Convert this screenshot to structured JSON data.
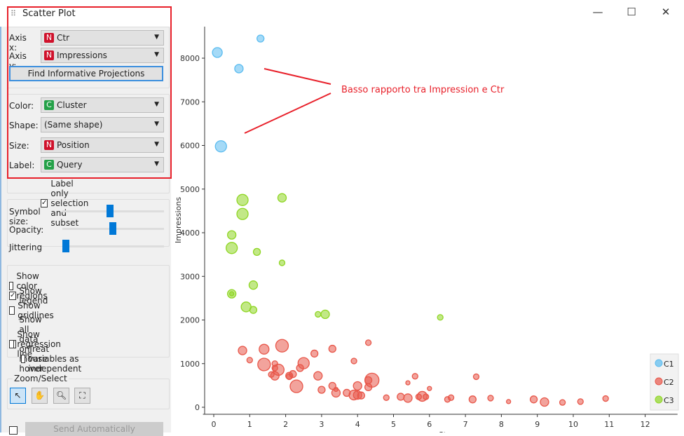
{
  "window": {
    "title": "Scatter Plot",
    "minimize": "—",
    "maximize": "☐",
    "close": "✕"
  },
  "controls": {
    "axis_x": {
      "label": "Axis x:",
      "type": "N",
      "value": "Ctr"
    },
    "axis_y": {
      "label": "Axis y:",
      "type": "N",
      "value": "Impressions"
    },
    "find_button": "Find Informative Projections",
    "color": {
      "label": "Color:",
      "type": "C",
      "value": "Cluster"
    },
    "shape": {
      "label": "Shape:",
      "value": "(Same shape)"
    },
    "size": {
      "label": "Size:",
      "type": "N",
      "value": "Position"
    },
    "label": {
      "label": "Label:",
      "type": "C",
      "value": "Query"
    },
    "label_only": {
      "label": "Label only selection and subset",
      "checked": true
    },
    "symbol_size": {
      "label": "Symbol size:",
      "value": 0.45
    },
    "opacity": {
      "label": "Opacity:",
      "value": 0.5
    },
    "jittering": {
      "label": "Jittering",
      "value": 0.0
    },
    "checkboxes": [
      {
        "label": "Show color regions",
        "checked": false
      },
      {
        "label": "Show legend",
        "checked": true
      },
      {
        "label": "Show gridlines",
        "checked": false
      },
      {
        "label": "Show all data on mouse hover",
        "checked": true
      },
      {
        "label": "Show regression line",
        "checked": false
      },
      {
        "label": "Treat variables as independent",
        "checked": false
      }
    ],
    "zoom_select": "Zoom/Select",
    "send_button": "Send Automatically"
  },
  "chart_data": {
    "type": "scatter",
    "xlabel": "Ctr",
    "ylabel": "Impressions",
    "xlim": [
      -0.3,
      12.9
    ],
    "ylim": [
      -150,
      8700
    ],
    "xticks": [
      0,
      1,
      2,
      3,
      4,
      5,
      6,
      7,
      8,
      9,
      10,
      11,
      12
    ],
    "yticks": [
      0,
      1000,
      2000,
      3000,
      4000,
      5000,
      6000,
      7000,
      8000
    ],
    "grid": false,
    "legend": "bottom-right",
    "annotation": "Basso rapporto tra Impression e Ctr",
    "colors": {
      "C1": "#5bbcf0",
      "C2": "#e8574a",
      "C3": "#8fd624"
    },
    "series": [
      {
        "name": "C1",
        "points": [
          [
            1.3,
            8450,
            5
          ],
          [
            0.1,
            8130,
            7
          ],
          [
            0.7,
            7760,
            6
          ],
          [
            0.2,
            5980,
            8
          ]
        ]
      },
      {
        "name": "C2",
        "points": [
          [
            0.8,
            1300,
            6
          ],
          [
            1.4,
            1330,
            7
          ],
          [
            1.9,
            1410,
            9
          ],
          [
            1.0,
            1080,
            4
          ],
          [
            1.4,
            980,
            9
          ],
          [
            1.7,
            1000,
            4
          ],
          [
            1.7,
            900,
            4
          ],
          [
            1.8,
            860,
            8
          ],
          [
            1.6,
            750,
            4
          ],
          [
            1.7,
            720,
            6
          ],
          [
            2.1,
            720,
            5
          ],
          [
            2.1,
            700,
            4
          ],
          [
            2.2,
            760,
            5
          ],
          [
            2.3,
            480,
            9
          ],
          [
            2.5,
            1010,
            8
          ],
          [
            2.4,
            900,
            5
          ],
          [
            2.8,
            1230,
            5
          ],
          [
            2.9,
            720,
            6
          ],
          [
            3.0,
            400,
            5
          ],
          [
            3.3,
            1340,
            5
          ],
          [
            3.3,
            490,
            5
          ],
          [
            3.4,
            410,
            3
          ],
          [
            3.4,
            330,
            6
          ],
          [
            3.7,
            330,
            5
          ],
          [
            3.9,
            1060,
            4
          ],
          [
            3.9,
            280,
            7
          ],
          [
            4.0,
            490,
            6
          ],
          [
            4.0,
            280,
            6
          ],
          [
            4.1,
            270,
            5
          ],
          [
            4.3,
            1480,
            4
          ],
          [
            4.3,
            620,
            5
          ],
          [
            4.3,
            460,
            5
          ],
          [
            4.4,
            620,
            10
          ],
          [
            4.8,
            220,
            4
          ],
          [
            5.2,
            240,
            5
          ],
          [
            5.4,
            560,
            3
          ],
          [
            5.4,
            210,
            6
          ],
          [
            5.6,
            710,
            4
          ],
          [
            5.7,
            240,
            4
          ],
          [
            5.8,
            250,
            7
          ],
          [
            5.9,
            240,
            4
          ],
          [
            6.0,
            430,
            3
          ],
          [
            6.5,
            180,
            4
          ],
          [
            6.6,
            220,
            4
          ],
          [
            7.2,
            180,
            5
          ],
          [
            7.3,
            700,
            4
          ],
          [
            7.7,
            210,
            4
          ],
          [
            8.2,
            130,
            3
          ],
          [
            8.9,
            180,
            5
          ],
          [
            9.2,
            120,
            6
          ],
          [
            9.7,
            110,
            4
          ],
          [
            10.2,
            130,
            4
          ],
          [
            10.9,
            200,
            4
          ],
          [
            12.6,
            150,
            4
          ]
        ]
      },
      {
        "name": "C3",
        "points": [
          [
            0.8,
            4750,
            8
          ],
          [
            1.9,
            4800,
            6
          ],
          [
            0.8,
            4430,
            8
          ],
          [
            0.5,
            3950,
            6
          ],
          [
            0.5,
            3650,
            8
          ],
          [
            1.2,
            3560,
            5
          ],
          [
            1.9,
            3310,
            4
          ],
          [
            1.1,
            2800,
            6
          ],
          [
            0.5,
            2600,
            6
          ],
          [
            0.5,
            2600,
            3
          ],
          [
            0.9,
            2300,
            7
          ],
          [
            1.1,
            2230,
            5
          ],
          [
            2.9,
            2130,
            4
          ],
          [
            3.1,
            2130,
            6
          ],
          [
            6.3,
            2060,
            4
          ]
        ]
      }
    ]
  }
}
